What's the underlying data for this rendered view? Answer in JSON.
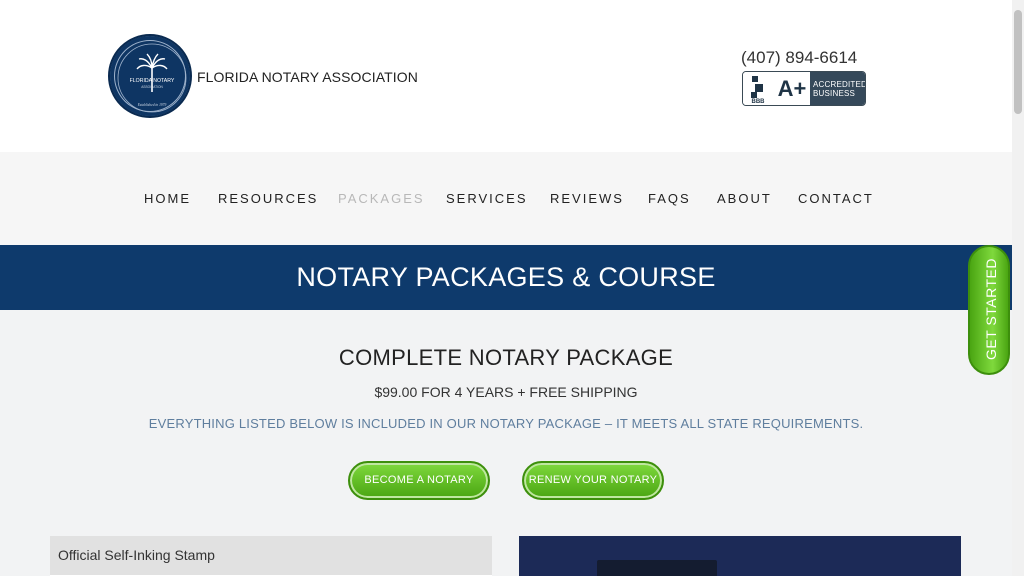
{
  "header": {
    "brand_name": "FLORIDA NOTARY ASSOCIATION",
    "seal_text_top": "FLORIDA NOTARY",
    "seal_text_small": "ASSOCIATION",
    "seal_text_bottom": "Established in 1979",
    "phone": "(407) 894-6614",
    "bbb": {
      "logo": "BBB",
      "grade": "A+",
      "line1": "ACCREDITED",
      "line2": "BUSINESS"
    }
  },
  "nav": {
    "items": [
      {
        "label": "HOME"
      },
      {
        "label": "RESOURCES"
      },
      {
        "label": "PACKAGES",
        "active": true
      },
      {
        "label": "SERVICES"
      },
      {
        "label": "REVIEWS"
      },
      {
        "label": "FAQS"
      },
      {
        "label": "ABOUT"
      },
      {
        "label": "CONTACT"
      }
    ]
  },
  "banner": {
    "title": "NOTARY PACKAGES & COURSE"
  },
  "package": {
    "title": "COMPLETE NOTARY PACKAGE",
    "price": "$99.00 FOR 4 YEARS + FREE SHIPPING",
    "note": "EVERYTHING LISTED BELOW IS INCLUDED IN OUR NOTARY PACKAGE – IT MEETS ALL STATE REQUIREMENTS.",
    "buttons": {
      "become": "BECOME A NOTARY",
      "renew": "RENEW YOUR NOTARY"
    },
    "items": [
      "Official Self-Inking Stamp"
    ]
  },
  "side_tab": {
    "label": "GET STARTED"
  },
  "colors": {
    "navy": "#0e3a6c",
    "green": "#5cbf1f",
    "nav_active": "#b8b8b8",
    "note_blue": "#5f7e9e"
  }
}
